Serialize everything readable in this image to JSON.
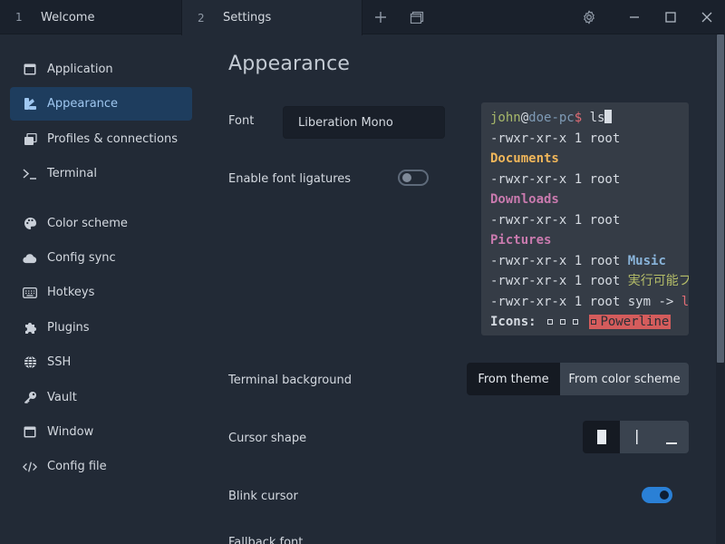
{
  "tabs": [
    {
      "num": "1",
      "title": "Welcome"
    },
    {
      "num": "2",
      "title": "Settings"
    }
  ],
  "sidebar": {
    "items": [
      {
        "label": "Application",
        "icon": "window-icon"
      },
      {
        "label": "Appearance",
        "icon": "palette-brush-icon",
        "active": true
      },
      {
        "label": "Profiles & connections",
        "icon": "windows-stack-icon"
      },
      {
        "label": "Terminal",
        "icon": "terminal-prompt-icon"
      },
      {
        "label": "Color scheme",
        "icon": "palette-icon"
      },
      {
        "label": "Config sync",
        "icon": "cloud-icon"
      },
      {
        "label": "Hotkeys",
        "icon": "keyboard-icon"
      },
      {
        "label": "Plugins",
        "icon": "puzzle-icon"
      },
      {
        "label": "SSH",
        "icon": "globe-icon"
      },
      {
        "label": "Vault",
        "icon": "key-icon"
      },
      {
        "label": "Window",
        "icon": "window-icon"
      },
      {
        "label": "Config file",
        "icon": "code-icon"
      }
    ]
  },
  "main": {
    "title": "Appearance",
    "font_label": "Font",
    "font_value": "Liberation Mono",
    "ligatures_label": "Enable font ligatures",
    "ligatures_on": false,
    "bg_label": "Terminal background",
    "bg_options": [
      "From theme",
      "From color scheme"
    ],
    "bg_selected": "From theme",
    "cursor_label": "Cursor shape",
    "cursor_options": [
      "block",
      "beam",
      "underline"
    ],
    "cursor_selected": "block",
    "blink_label": "Blink cursor",
    "blink_on": true,
    "cut_label": "Fallback font"
  },
  "preview": {
    "user": "john",
    "at": "@",
    "host": "doe-pc",
    "prompt": "$",
    "cmd": "ls",
    "perm": "-rwxr-xr-x 1 root",
    "dir1": "Documents",
    "dir2": "Downloads",
    "dir3": "Pictures",
    "music": "Music",
    "exec": "実行可能フ",
    "sym": "sym ->",
    "link": "l",
    "icons_label": "Icons:",
    "powerline": "Powerline"
  },
  "colors": {
    "accent": "#2a80d6",
    "active_bg": "#1e3d5e",
    "bg": "#222a36"
  }
}
